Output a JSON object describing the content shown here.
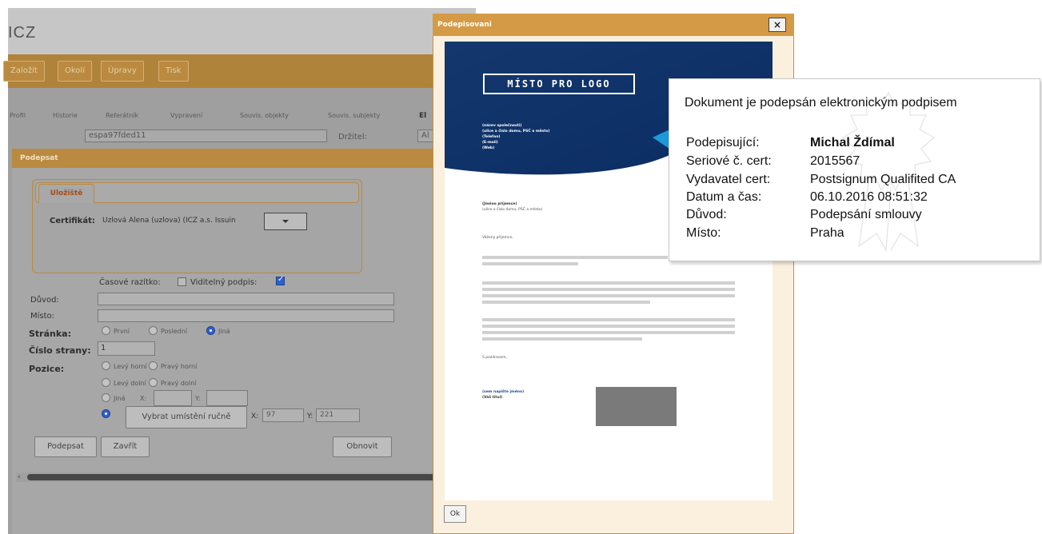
{
  "app": {
    "title": "ICZ",
    "menu": [
      "Založit",
      "Okolí",
      "Úpravy",
      "Tisk"
    ],
    "tabs": [
      "Profil",
      "Historie",
      "Referátník",
      "Vypravení",
      "Souvis. objekty",
      "Souvis. subjekty",
      "El"
    ],
    "id_value": "espa97fded11",
    "holder_label": "Držitel:",
    "holder_value": "Al"
  },
  "podepsat": {
    "title": "Podepsat",
    "tab": "Uložiště",
    "cert_label": "Certifikát:",
    "cert_value": "Uzlová Alena (uzlova) (ICZ a.s. Issuin",
    "timestamp_label": "Časové razítko:",
    "visible_sig_label": "Viditelný podpis:",
    "reason_label": "Důvod:",
    "place_label": "Místo:",
    "page_label": "Stránka:",
    "page_options": [
      "První",
      "Poslední",
      "Jiná"
    ],
    "page_number_label": "Číslo strany:",
    "page_number_value": "1",
    "position_label": "Pozice:",
    "position_options": [
      "Levý horní",
      "Pravý horní",
      "Levý dolní",
      "Pravý dolní",
      "Jiná"
    ],
    "x_label": "X:",
    "y_label": "Y:",
    "manual_btn": "Vybrat umístění ručně",
    "manual_x": "97",
    "manual_y": "221",
    "sign_btn": "Podepsat",
    "close_btn": "Zavřít",
    "refresh_btn": "Obnovit"
  },
  "podepisovani": {
    "title": "Podepisovani",
    "close_symbol": "×",
    "logo_text": "MÍSTO PRO LOGO",
    "header_lines": "(název společnosti)\n(ulice a číslo domu, PSČ a město)\n(Telefon)\n(E-mail)\n(Web)",
    "recipient_name": "(Jméno příjemce)",
    "recipient_addr": "(ulice a číslo domu, PSČ a město)",
    "greeting": "Vážený příjemce,",
    "closing": "S pozdravem,",
    "sender_name": "(sem napište jméno)",
    "sender_role": "(Váš titul)",
    "ok_btn": "Ok"
  },
  "signature_info": {
    "title": "Dokument je podepsán elektronickým podpisem",
    "rows": [
      {
        "label": "Podepisující:",
        "value": "Michal Ždímal"
      },
      {
        "label": "Seriové č. cert:",
        "value": "2015567"
      },
      {
        "label": "Vydavatel cert:",
        "value": "Postsignum Qualifited CA"
      },
      {
        "label": "Datum a čas:",
        "value": "06.10.2016 08:51:32"
      },
      {
        "label": "Důvod:",
        "value": "Podepsání smlouvy"
      },
      {
        "label": "Místo:",
        "value": "Praha"
      }
    ]
  }
}
